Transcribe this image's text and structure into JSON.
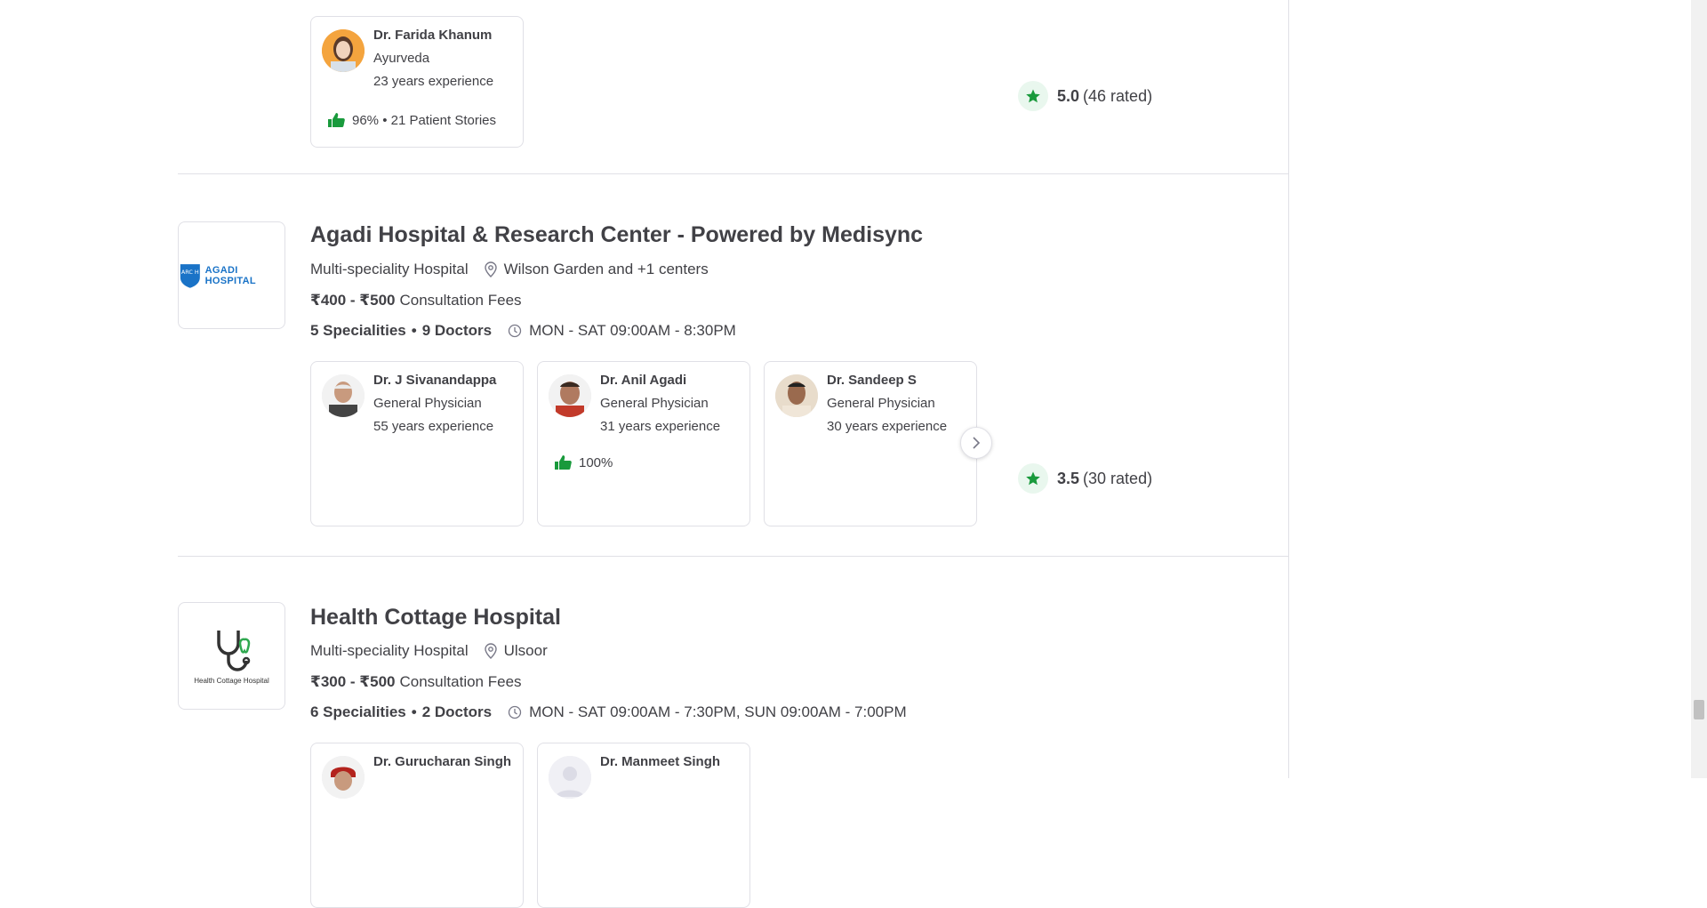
{
  "listings": [
    {
      "doctors": [
        {
          "name": "Dr. Farida Khanum",
          "speciality": "Ayurveda",
          "experience": "23 years experience",
          "recommendation": "96% • 21 Patient Stories"
        }
      ],
      "rating": {
        "score": "5.0",
        "count": "(46 rated)"
      }
    },
    {
      "name": "Agadi Hospital & Research Center - Powered by Medisync",
      "type": "Multi-speciality Hospital",
      "location": "Wilson Garden and +1 centers",
      "fees_range": "₹400 - ₹500",
      "fees_label": "Consultation Fees",
      "specialities": "5 Specialities",
      "doctors_count": "9 Doctors",
      "timings": "MON - SAT 09:00AM - 8:30PM",
      "logo_text": "AGADI HOSPITAL",
      "logo_badge": "ARC H",
      "doctors": [
        {
          "name": "Dr. J Sivanandappa",
          "speciality": "General Physician",
          "experience": "55 years experience",
          "recommendation": ""
        },
        {
          "name": "Dr. Anil Agadi",
          "speciality": "General Physician",
          "experience": "31 years experience",
          "recommendation": "100%"
        },
        {
          "name": "Dr. Sandeep S",
          "speciality": "General Physician",
          "experience": "30 years experience",
          "recommendation": ""
        }
      ],
      "rating": {
        "score": "3.5",
        "count": "(30 rated)"
      }
    },
    {
      "name": "Health Cottage Hospital",
      "type": "Multi-speciality Hospital",
      "location": "Ulsoor",
      "fees_range": "₹300 - ₹500",
      "fees_label": "Consultation Fees",
      "specialities": "6 Specialities",
      "doctors_count": "2 Doctors",
      "timings": "MON - SAT 09:00AM - 7:30PM, SUN 09:00AM - 7:00PM",
      "logo_text": "Health Cottage Hospital",
      "doctors": [
        {
          "name": "Dr. Gurucharan Singh"
        },
        {
          "name": "Dr. Manmeet Singh"
        }
      ]
    }
  ],
  "colors": {
    "accent_green": "#14bef0",
    "star_green": "#199a3c",
    "text": "#414146",
    "border": "#e0e0e6"
  }
}
